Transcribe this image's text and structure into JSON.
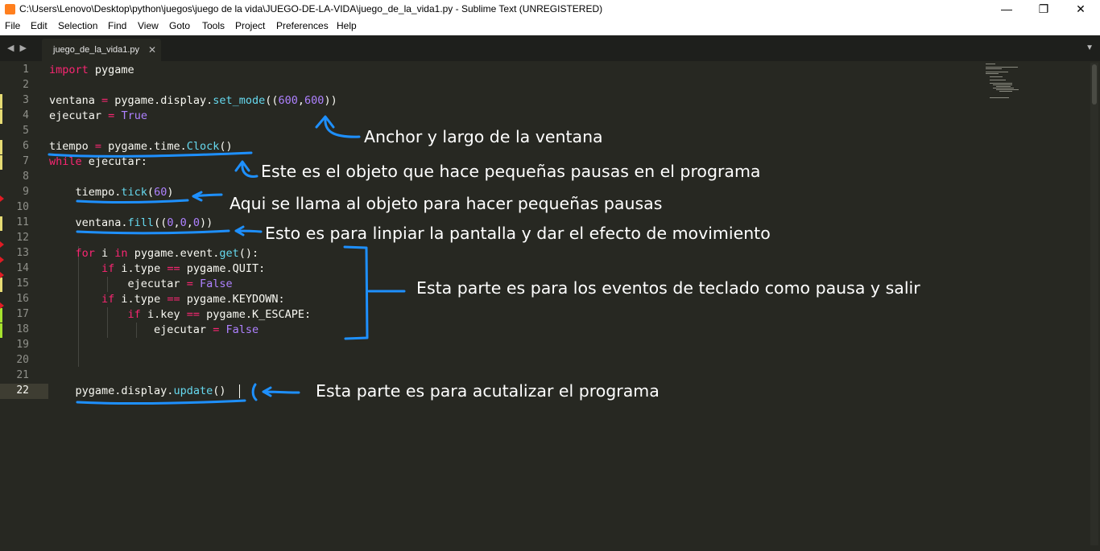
{
  "window": {
    "title": "C:\\Users\\Lenovo\\Desktop\\python\\juegos\\juego de la vida\\JUEGO-DE-LA-VIDA\\juego_de_la_vida1.py - Sublime Text (UNREGISTERED)",
    "minimize_glyph": "—",
    "maximize_glyph": "❐",
    "close_glyph": "✕"
  },
  "menu": [
    "File",
    "Edit",
    "Selection",
    "Find",
    "View",
    "Goto",
    "Tools",
    "Project",
    "Preferences",
    "Help"
  ],
  "tabs": {
    "nav_arrows": "◀ ▶",
    "active_label": "juego_de_la_vida1.py",
    "close_glyph": "✕",
    "dropdown_glyph": "▼"
  },
  "line_numbers": [
    "1",
    "2",
    "3",
    "4",
    "5",
    "6",
    "7",
    "8",
    "9",
    "10",
    "11",
    "12",
    "13",
    "14",
    "15",
    "16",
    "17",
    "18",
    "19",
    "20",
    "21",
    "22"
  ],
  "current_line": "22",
  "annotations": {
    "window_size": "Anchor y largo de la ventana",
    "clock_object": "Este es el objeto que hace pequeñas pausas en el programa",
    "tick_call": "Aqui se llama al objeto para hacer pequeñas pausas",
    "fill_screen": "Esto es para linpiar la pantalla y dar el efecto de movimiento",
    "events": "Esta parte es para los eventos de teclado como pausa y salir",
    "update": "Esta parte es para acutalizar el programa"
  },
  "icons": [
    "sublime-text-app-icon",
    "chevron-left-right-icon",
    "close-icon",
    "chevron-down-icon"
  ],
  "colors": {
    "editor_bg": "#272822",
    "keyword": "#f92672",
    "function": "#66d9ef",
    "number": "#ae81ff",
    "annotation_ink": "#1e90ff"
  }
}
